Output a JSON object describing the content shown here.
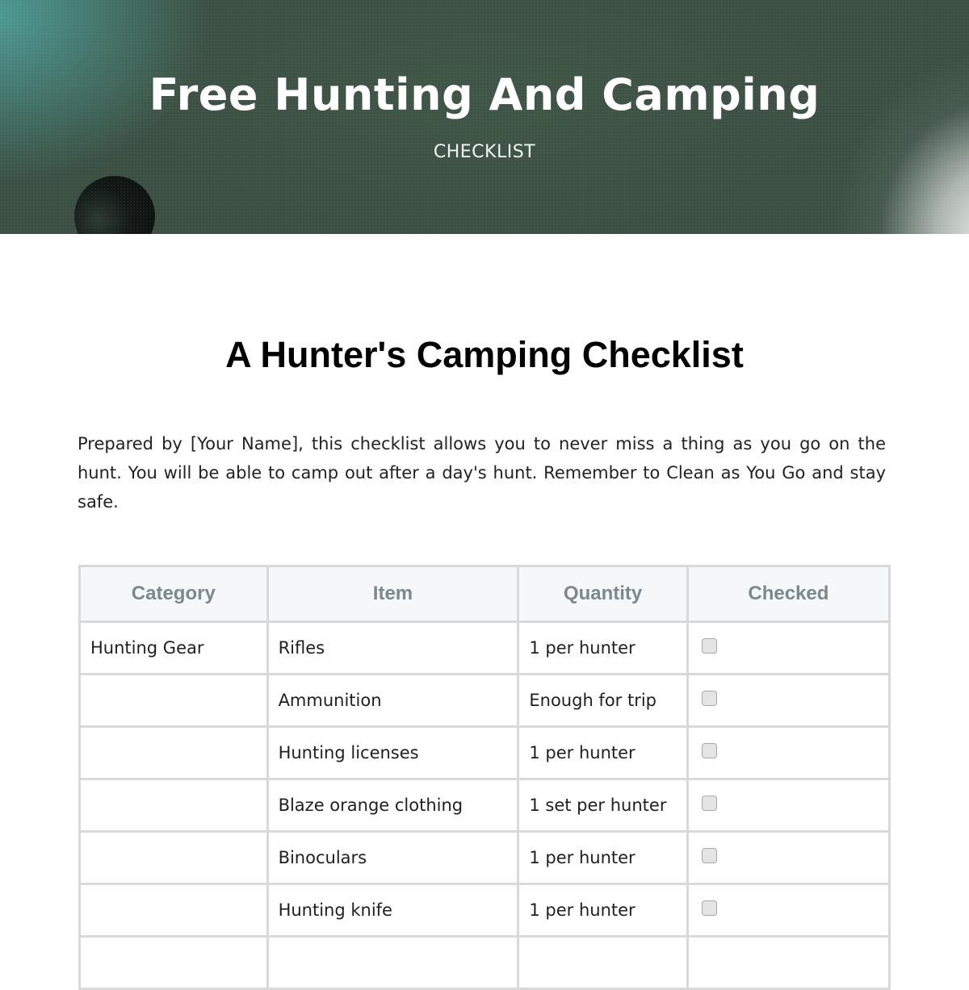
{
  "hero": {
    "title": "Free Hunting And Camping",
    "subtitle": "CHECKLIST"
  },
  "document": {
    "title": "A Hunter's Camping Checklist",
    "intro": "Prepared by [Your Name], this checklist allows you to never miss a thing as you go on the hunt. You will be able to camp out after a day's hunt. Remember to Clean as You Go and stay safe."
  },
  "table": {
    "headers": [
      "Category",
      "Item",
      "Quantity",
      "Checked"
    ],
    "rows": [
      {
        "category": "Hunting Gear",
        "item": "Rifles",
        "quantity": "1 per hunter",
        "checked": false
      },
      {
        "category": "",
        "item": "Ammunition",
        "quantity": "Enough for trip",
        "checked": false
      },
      {
        "category": "",
        "item": "Hunting licenses",
        "quantity": "1 per hunter",
        "checked": false
      },
      {
        "category": "",
        "item": "Blaze orange clothing",
        "quantity": "1 set per hunter",
        "checked": false
      },
      {
        "category": "",
        "item": "Binoculars",
        "quantity": "1 per hunter",
        "checked": false
      },
      {
        "category": "",
        "item": "Hunting knife",
        "quantity": "1 per hunter",
        "checked": false
      },
      {
        "category": "",
        "item": "",
        "quantity": "",
        "checked": false
      }
    ]
  },
  "colors": {
    "hero_green": "#3b4e41",
    "header_bg": "#f5f7f9",
    "header_text": "#7c8790",
    "border": "#d9d9d9"
  }
}
